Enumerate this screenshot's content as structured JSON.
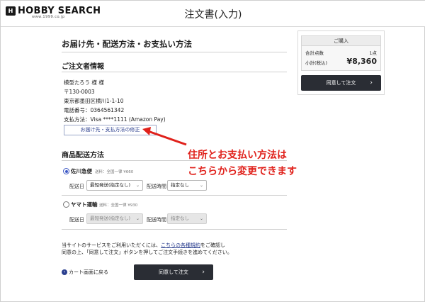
{
  "header": {
    "logo_mark": "H",
    "logo_text": "HOBBY SEARCH",
    "logo_sub": "www.1999.co.jp",
    "title": "注文書(入力)"
  },
  "main": {
    "section_title": "お届け先・配送方法・お支払い方法",
    "orderer": {
      "title": "ご注文者情報",
      "name": "模型たろう 様 様",
      "postal": "〒130-0003",
      "address": "東京都墨田区横川1-1-10",
      "phone": "電話番号：0364561342",
      "payment": "支払方法：Visa ****1111 (Amazon Pay)",
      "edit_button": "お届け先・支払方法の修正"
    },
    "shipping": {
      "title": "商品配送方法",
      "carriers": [
        {
          "name": "佐川急便",
          "fee": "送料：全国一律 ¥660",
          "selected": true,
          "date_label": "配送日",
          "date_value": "最短発送(指定なし)",
          "time_label": "配送時間",
          "time_value": "指定なし"
        },
        {
          "name": "ヤマト運輸",
          "fee": "送料：全国一律 ¥930",
          "selected": false,
          "date_label": "配送日",
          "date_value": "最短発送(指定なし)",
          "time_label": "配送時間",
          "time_value": "指定なし"
        }
      ]
    },
    "notice": {
      "line1_pre": "当サイトのサービスをご利用いただくには、",
      "line1_link": "こちらの各種規約",
      "line1_post": "をご確認し",
      "line2": "同意の上、「同意して注文」ボタンを押してご注文手続きを進めてください。"
    },
    "back_link": "カート画面に戻る",
    "confirm_button": "同意して注文"
  },
  "summary": {
    "head": "ご購入",
    "count_label": "合計点数",
    "count_value": "1点",
    "subtotal_label": "小計(税込)",
    "subtotal_value": "¥8,360",
    "confirm_button": "同意して注文"
  },
  "annotation": {
    "line1": "住所とお支払い方法は",
    "line2": "こちらから変更できます",
    "color": "#e0211b"
  },
  "icons": {
    "chevron": "⌄",
    "arrow_right": "›",
    "back": "‹"
  }
}
